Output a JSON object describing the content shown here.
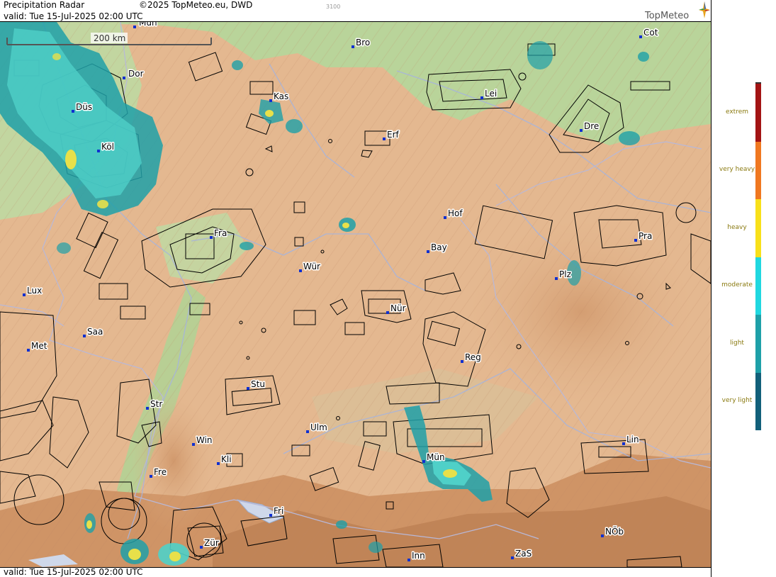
{
  "header": {
    "title": "Precipitation Radar",
    "copyright": "©2025 TopMeteo.eu, DWD",
    "valid": "valid:  Tue  15-Jul-2025 02:00 UTC",
    "code": "3100",
    "logo_text": "TopMeteo"
  },
  "footer": {
    "valid": "valid:  Tue  15-Jul-2025 02:00 UTC"
  },
  "scale": {
    "label": "200 km"
  },
  "legend": {
    "levels": [
      {
        "label": "extrem",
        "color": "#a31414"
      },
      {
        "label": "very heavy",
        "color": "#f07820"
      },
      {
        "label": "heavy",
        "color": "#f8e01a"
      },
      {
        "label": "moderate",
        "color": "#20d8e0"
      },
      {
        "label": "light",
        "color": "#1ea0a8"
      },
      {
        "label": "very light",
        "color": "#12607a"
      }
    ]
  },
  "cities": [
    {
      "name": "Mün",
      "key": "mon_top"
    },
    {
      "name": "Bro",
      "key": "bro"
    },
    {
      "name": "Cot",
      "key": "cot"
    },
    {
      "name": "Dor",
      "key": "dor"
    },
    {
      "name": "Kas",
      "key": "kas"
    },
    {
      "name": "Lei",
      "key": "lei"
    },
    {
      "name": "Düs",
      "key": "dus"
    },
    {
      "name": "Erf",
      "key": "erf"
    },
    {
      "name": "Dre",
      "key": "dre"
    },
    {
      "name": "Köl",
      "key": "kol"
    },
    {
      "name": "Hof",
      "key": "hof"
    },
    {
      "name": "Fra",
      "key": "fra"
    },
    {
      "name": "Pra",
      "key": "pra"
    },
    {
      "name": "Bay",
      "key": "bay"
    },
    {
      "name": "Wür",
      "key": "wur"
    },
    {
      "name": "Plz",
      "key": "plz"
    },
    {
      "name": "Lux",
      "key": "lux"
    },
    {
      "name": "Nür",
      "key": "nur"
    },
    {
      "name": "Saa",
      "key": "saa"
    },
    {
      "name": "Met",
      "key": "met"
    },
    {
      "name": "Reg",
      "key": "reg"
    },
    {
      "name": "Stu",
      "key": "stu"
    },
    {
      "name": "Str",
      "key": "str"
    },
    {
      "name": "Ulm",
      "key": "ulm"
    },
    {
      "name": "Win",
      "key": "win"
    },
    {
      "name": "Lin",
      "key": "lin"
    },
    {
      "name": "Mün",
      "key": "mun"
    },
    {
      "name": "Kli",
      "key": "kli"
    },
    {
      "name": "Fre",
      "key": "fre"
    },
    {
      "name": "Fri",
      "key": "fri"
    },
    {
      "name": "NÖb",
      "key": "nob"
    },
    {
      "name": "Zür",
      "key": "zur"
    },
    {
      "name": "ZaS",
      "key": "zas"
    },
    {
      "name": "Inn",
      "key": "inn"
    }
  ],
  "colors": {
    "terrain_low": "#a8cf8a",
    "terrain_mid": "#e2b48a",
    "terrain_high": "#d49a6c",
    "radar_light": "#1ea0a8",
    "radar_moderate": "#4fd0c8",
    "radar_heavy": "#e8e04a"
  }
}
